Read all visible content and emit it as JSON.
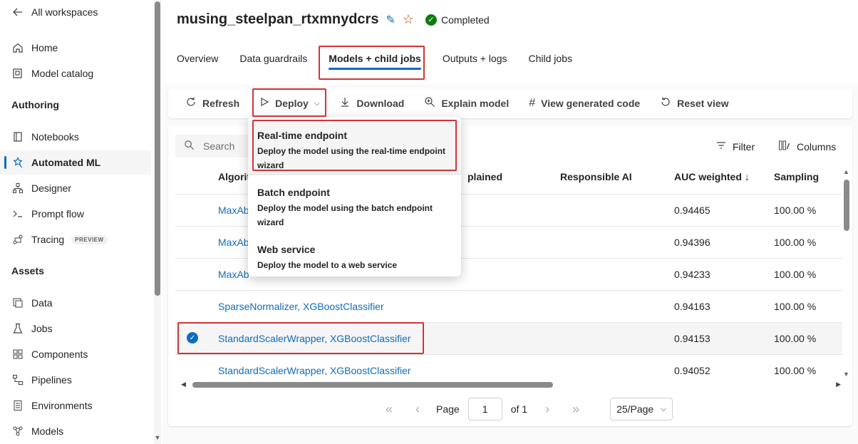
{
  "sidebar": {
    "back_label": "All workspaces",
    "items_top": [
      {
        "label": "Home",
        "icon": "home-icon"
      },
      {
        "label": "Model catalog",
        "icon": "catalog-icon"
      }
    ],
    "authoring_label": "Authoring",
    "authoring_items": [
      {
        "label": "Notebooks",
        "icon": "notebook-icon"
      },
      {
        "label": "Automated ML",
        "icon": "automl-icon"
      },
      {
        "label": "Designer",
        "icon": "designer-icon"
      },
      {
        "label": "Prompt flow",
        "icon": "prompt-flow-icon"
      },
      {
        "label": "Tracing",
        "icon": "tracing-icon",
        "badge": "PREVIEW"
      }
    ],
    "assets_label": "Assets",
    "assets_items": [
      {
        "label": "Data",
        "icon": "data-icon"
      },
      {
        "label": "Jobs",
        "icon": "jobs-icon"
      },
      {
        "label": "Components",
        "icon": "components-icon"
      },
      {
        "label": "Pipelines",
        "icon": "pipelines-icon"
      },
      {
        "label": "Environments",
        "icon": "environments-icon"
      },
      {
        "label": "Models",
        "icon": "models-icon"
      }
    ]
  },
  "header": {
    "title": "musing_steelpan_rtxmnydcrs",
    "status": "Completed"
  },
  "tabs": [
    {
      "label": "Overview"
    },
    {
      "label": "Data guardrails"
    },
    {
      "label": "Models + child jobs"
    },
    {
      "label": "Outputs + logs"
    },
    {
      "label": "Child jobs"
    }
  ],
  "toolbar": {
    "refresh": "Refresh",
    "deploy": "Deploy",
    "download": "Download",
    "explain": "Explain model",
    "view_code": "View generated code",
    "reset": "Reset view"
  },
  "grid": {
    "search_placeholder": "Search",
    "filter_label": "Filter",
    "columns_label": "Columns",
    "headers": {
      "algorithm": "Algorit",
      "explained": "plained",
      "responsible": "Responsible AI",
      "auc": "AUC weighted ↓",
      "sampling": "Sampling"
    },
    "rows": [
      {
        "algorithm": "MaxAb",
        "auc": "0.94465",
        "sampling": "100.00 %"
      },
      {
        "algorithm": "MaxAb",
        "auc": "0.94396",
        "sampling": "100.00 %"
      },
      {
        "algorithm": "MaxAb",
        "auc": "0.94233",
        "sampling": "100.00 %"
      },
      {
        "algorithm": "SparseNormalizer, XGBoostClassifier",
        "auc": "0.94163",
        "sampling": "100.00 %"
      },
      {
        "algorithm": "StandardScalerWrapper, XGBoostClassifier",
        "auc": "0.94153",
        "sampling": "100.00 %"
      },
      {
        "algorithm": "StandardScalerWrapper, XGBoostClassifier",
        "auc": "0.94052",
        "sampling": "100.00 %"
      }
    ]
  },
  "pager": {
    "page_label": "Page",
    "page_value": "1",
    "of_label": "of 1",
    "page_size": "25/Page"
  },
  "deploy_menu": [
    {
      "title": "Real-time endpoint",
      "desc": "Deploy the model using the real-time endpoint wizard"
    },
    {
      "title": "Batch endpoint",
      "desc": "Deploy the model using the batch endpoint wizard"
    },
    {
      "title": "Web service",
      "desc": "Deploy the model to a web service"
    }
  ],
  "colors": {
    "accent": "#0f6cbd",
    "highlight": "#d13438",
    "success": "#107c10"
  }
}
